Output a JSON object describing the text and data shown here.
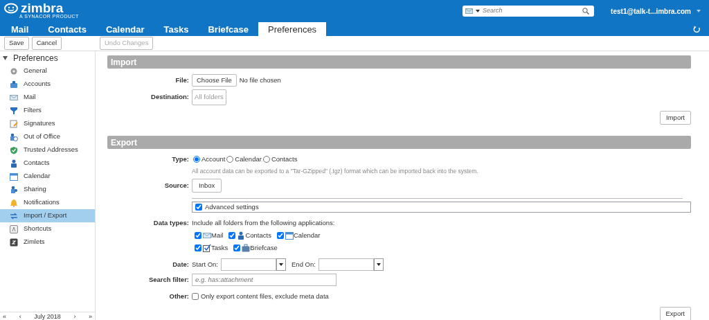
{
  "header": {
    "logo_text": "zimbra",
    "logo_subtext": "A SYNACOR PRODUCT",
    "search": {
      "placeholder": "Search"
    },
    "user": "test1@talk-t...imbra.com"
  },
  "tabs": [
    {
      "label": "Mail",
      "selected": false
    },
    {
      "label": "Contacts",
      "selected": false
    },
    {
      "label": "Calendar",
      "selected": false
    },
    {
      "label": "Tasks",
      "selected": false
    },
    {
      "label": "Briefcase",
      "selected": false
    },
    {
      "label": "Preferences",
      "selected": true
    }
  ],
  "toolbar": {
    "buttons": [
      {
        "label": "Save",
        "disabled": false
      },
      {
        "label": "Cancel",
        "disabled": false
      }
    ],
    "undo": {
      "label": "Undo Changes",
      "disabled": true
    }
  },
  "sidebar": {
    "title": "Preferences",
    "expanded": true,
    "items": [
      {
        "label": "General",
        "selected": false
      },
      {
        "label": "Accounts",
        "selected": false
      },
      {
        "label": "Mail",
        "selected": false
      },
      {
        "label": "Filters",
        "selected": false
      },
      {
        "label": "Signatures",
        "selected": false
      },
      {
        "label": "Out of Office",
        "selected": false
      },
      {
        "label": "Trusted Addresses",
        "selected": false
      },
      {
        "label": "Contacts",
        "selected": false
      },
      {
        "label": "Calendar",
        "selected": false
      },
      {
        "label": "Sharing",
        "selected": false
      },
      {
        "label": "Notifications",
        "selected": false
      },
      {
        "label": "Import / Export",
        "selected": true
      },
      {
        "label": "Shortcuts",
        "selected": false
      },
      {
        "label": "Zimlets",
        "selected": false
      }
    ],
    "calendar": {
      "prev_year": "«",
      "prev": "‹",
      "month": "July 2018",
      "next": "›",
      "next_year": "»"
    }
  },
  "import": {
    "title": "Import",
    "file_label": "File:",
    "choose_button": "Choose File",
    "file_status": "No file chosen",
    "destination_label": "Destination:",
    "destination_button": "All folders",
    "button": "Import"
  },
  "export": {
    "title": "Export",
    "type_label": "Type:",
    "type_options": [
      {
        "label": "Account",
        "selected": true
      },
      {
        "label": "Calendar",
        "selected": false
      },
      {
        "label": "Contacts",
        "selected": false
      }
    ],
    "type_note": "All account data can be exported to a \"Tar-GZipped\" (.tgz) format which can be imported back into the system.",
    "source_label": "Source:",
    "source_button": "Inbox",
    "advanced": {
      "label": "Advanced settings",
      "checked": true
    },
    "data_types_label": "Data types:",
    "data_types_note": "Include all folders from the following applications:",
    "data_types": [
      {
        "label": "Mail",
        "checked": true
      },
      {
        "label": "Contacts",
        "checked": true
      },
      {
        "label": "Calendar",
        "checked": true
      },
      {
        "label": "Tasks",
        "checked": true
      },
      {
        "label": "Briefcase",
        "checked": true
      }
    ],
    "date_label": "Date:",
    "start_label": "Start On:",
    "end_label": "End On:",
    "search_filter_label": "Search filter:",
    "search_filter_placeholder": "e.g. has:attachment",
    "other_label": "Other:",
    "other": {
      "label": "Only export content files, exclude meta data",
      "checked": false
    },
    "button": "Export"
  }
}
